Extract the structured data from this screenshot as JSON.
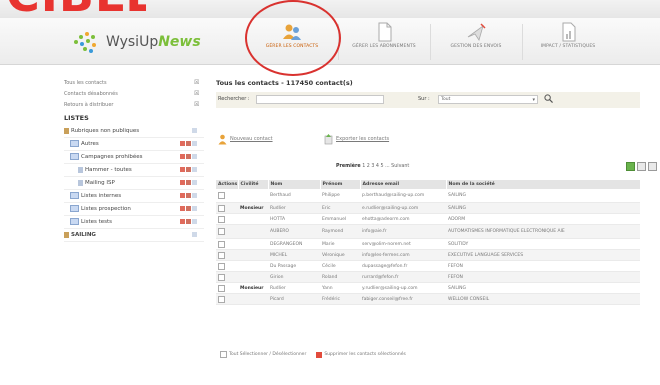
{
  "banner": {
    "title": "CIBLER"
  },
  "app": {
    "logo_main": "WysiUp",
    "logo_accent": "News"
  },
  "nav": {
    "tabs": [
      {
        "label": "GÉRER LES CONTACTS",
        "icon": "contacts-icon",
        "active": true
      },
      {
        "label": "GÉRER LES ABONNEMENTS",
        "icon": "document-icon",
        "active": false
      },
      {
        "label": "GESTION DES ENVOIS",
        "icon": "send-icon",
        "active": false
      },
      {
        "label": "IMPACT / STATISTIQUES",
        "icon": "stats-icon",
        "active": false
      }
    ]
  },
  "sidebar": {
    "links": [
      "Tous les contacts",
      "Contacts désabonnés",
      "Retours à distribuer"
    ],
    "lists_heading": "LISTES",
    "items": [
      {
        "label": "Rubriques non publiques",
        "level": 0
      },
      {
        "label": "Autres",
        "level": 1
      },
      {
        "label": "Campagnes prohibées",
        "level": 1
      },
      {
        "label": "Hammer - toutes",
        "level": 2
      },
      {
        "label": "Mailing ISP",
        "level": 2
      },
      {
        "label": "Listes internes",
        "level": 1
      },
      {
        "label": "Listes prospection",
        "level": 1
      },
      {
        "label": "Listes tests",
        "level": 1
      },
      {
        "label": "SAILING",
        "level": 0
      }
    ]
  },
  "main": {
    "title": "Tous les contacts - 117450 contact(s)",
    "search_label": "Rechercher :",
    "search_value": "",
    "in_label": "Sur :",
    "in_value": "Tout",
    "add_contact": "Nouveau contact",
    "export": "Exporter les contacts",
    "pager_label": "Première",
    "pager_pages": "1 2 3 4 5 ... Suivant"
  },
  "table": {
    "columns": [
      "Actions",
      "Civilité",
      "Nom",
      "Prénom",
      "Adresse email",
      "Nom de la société"
    ],
    "rows": [
      {
        "civ": "",
        "nom": "Berthaud",
        "prenom": "Philippe",
        "email": "p.berthaud@sailing-up.com",
        "societe": "SAILING",
        "tall": true
      },
      {
        "civ": "Monsieur",
        "nom": "Rudlier",
        "prenom": "Eric",
        "email": "e.rudlier@sailing-up.com",
        "societe": "SAILING",
        "tall": false
      },
      {
        "civ": "",
        "nom": "HOTTA",
        "prenom": "Emmanuel",
        "email": "ehotta@adeorm.com",
        "societe": "ADORM",
        "tall": false
      },
      {
        "civ": "",
        "nom": "AUBERO",
        "prenom": "Raymond",
        "email": "info@aie.fr",
        "societe": "AUTOMATISMES INFORMATIQUE ELECTRONIQUE AIE",
        "tall": true
      },
      {
        "civ": "",
        "nom": "DEGRANGEON",
        "prenom": "Marie",
        "email": "serv@olim-norem.net",
        "societe": "SOLITIDY",
        "tall": false
      },
      {
        "civ": "",
        "nom": "MICHEL",
        "prenom": "Véronique",
        "email": "info@les-fermes.com",
        "societe": "EXECUTIVE LANGUAGE SERVICES",
        "tall": false
      },
      {
        "civ": "",
        "nom": "Du Passage",
        "prenom": "Cécile",
        "email": "dupassage@fefon.fr",
        "societe": "FEFON",
        "tall": false
      },
      {
        "civ": "",
        "nom": "Girion",
        "prenom": "Roland",
        "email": "rurrard@fefon.fr",
        "societe": "FEFON",
        "tall": false
      },
      {
        "civ": "Monsieur",
        "nom": "Rudlier",
        "prenom": "Yann",
        "email": "y.rudlier@sailing-up.com",
        "societe": "SAILING",
        "tall": false
      },
      {
        "civ": "",
        "nom": "Picard",
        "prenom": "Frédéric",
        "email": "fabiger.conseil@free.fr",
        "societe": "WELLOW CONSEIL",
        "tall": false
      }
    ]
  },
  "footer": {
    "select_all": "Tout Sélectionner / Désélectionner",
    "delete_selected": "Supprimer les contacts sélectionnés"
  },
  "colors": {
    "accent": "#d9322f",
    "brand_green": "#7cbf3a",
    "active_tab": "#c85a00"
  }
}
